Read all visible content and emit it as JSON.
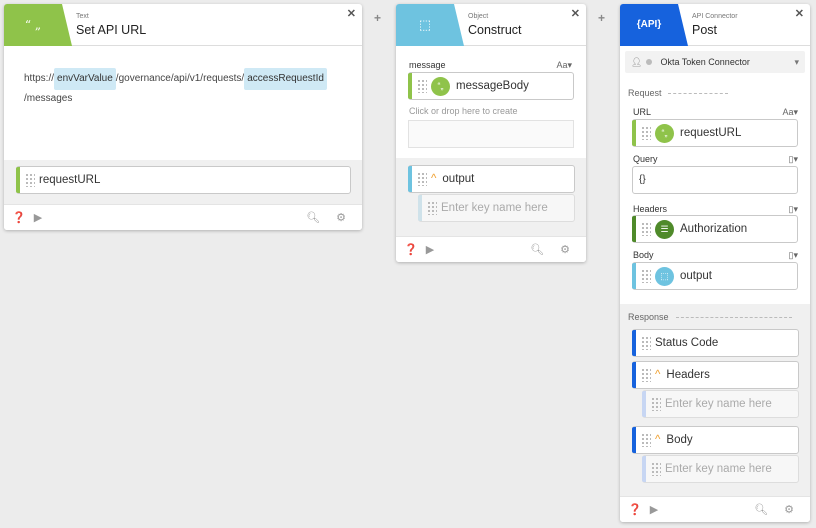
{
  "text_card": {
    "type_label": "Text",
    "title": "Set API URL",
    "url_prefix": "https://",
    "url_pill_1": "envVarValue",
    "url_mid": "/governance/api/v1/requests/",
    "url_pill_2": "accessRequestId",
    "url_suffix": "/messages",
    "output_field": "requestURL",
    "icon": "quote-icon",
    "color": "#8fc34a"
  },
  "object_card": {
    "type_label": "Object",
    "title": "Construct",
    "message_label": "message",
    "aa_label": "Aa▾",
    "message_value": "messageBody",
    "drop_hint": "Click or drop here to create",
    "output_field": "output",
    "key_placeholder": "Enter key name here",
    "icon": "cube-icon",
    "color": "#6ec3e0"
  },
  "api_card": {
    "type_label": "API Connector",
    "title": "Post",
    "connector": "Okta Token Connector",
    "request_label": "Request",
    "url_label": "URL",
    "aa_label": "Aa▾",
    "url_value": "requestURL",
    "query_label": "Query",
    "query_value": "{}",
    "headers_label": "Headers",
    "headers_value": "Authorization",
    "body_label": "Body",
    "body_value": "output",
    "response_label": "Response",
    "resp_status": "Status Code",
    "resp_headers": "Headers",
    "resp_body": "Body",
    "key_placeholder": "Enter key name here",
    "icon": "api-icon",
    "color": "#1662dd"
  }
}
